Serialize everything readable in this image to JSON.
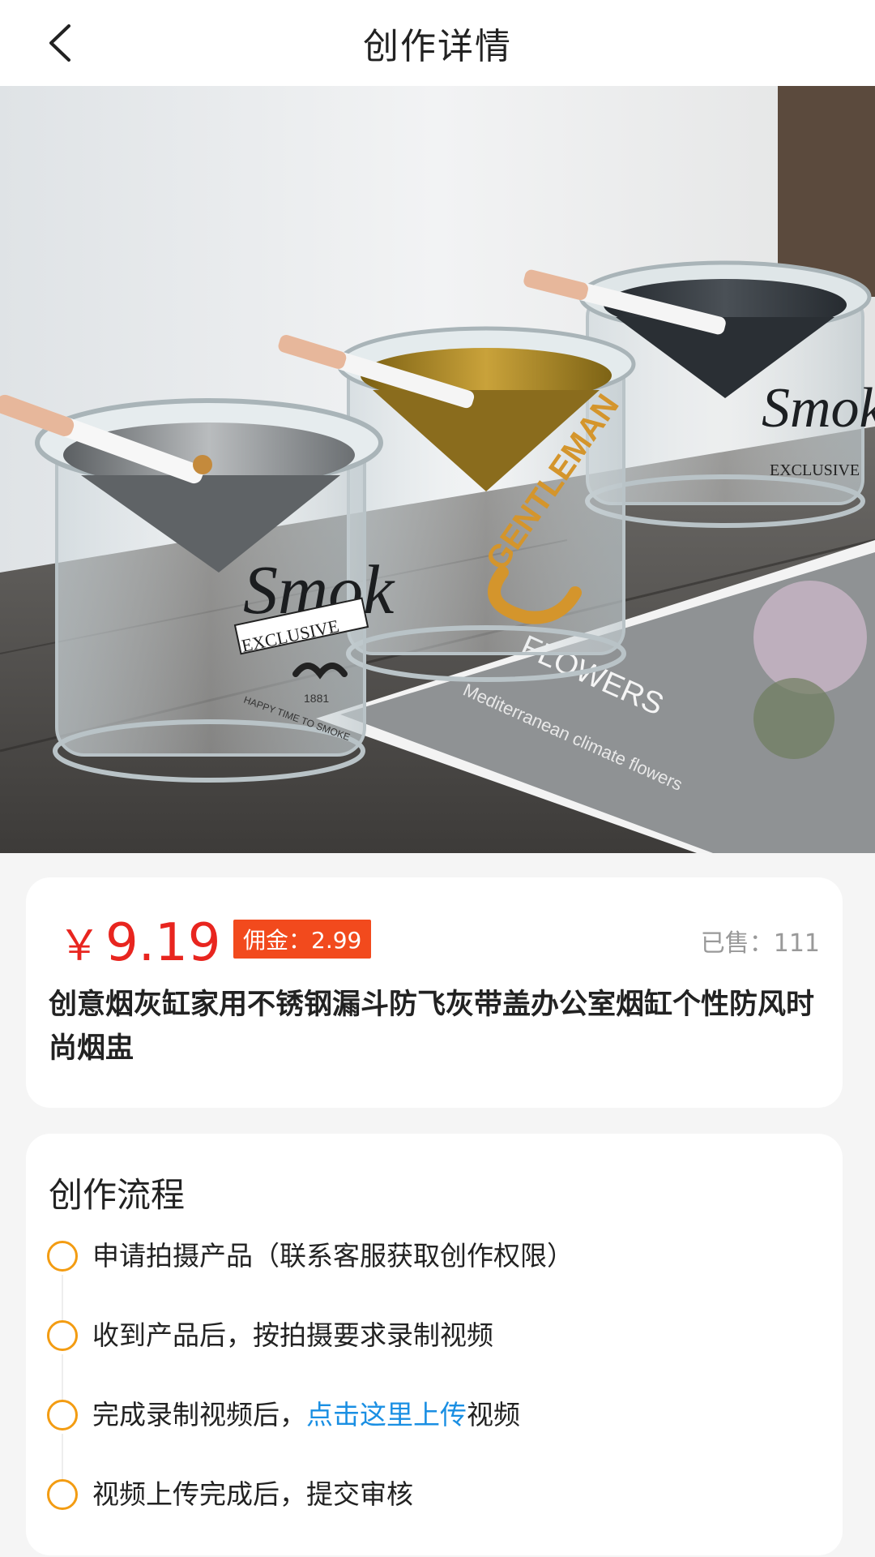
{
  "header": {
    "title": "创作详情"
  },
  "product": {
    "price_symbol": "￥",
    "price": "9.19",
    "commission": "佣金：2.99",
    "sold": "已售：111",
    "title": "创意烟灰缸家用不锈钢漏斗防飞灰带盖办公室烟缸个性防风时尚烟盅",
    "image": {
      "texts": {
        "left_jar_script": "Smok",
        "left_jar_label": "EXCLUSIVE",
        "left_jar_tagline": "HAPPY TIME TO SMOKE",
        "left_jar_year": "1881",
        "middle_jar_label": "GENTLEMAN",
        "right_jar_script": "Smok",
        "right_jar_label": "EXCLUSIVE",
        "magazine_title": "FLOWERS",
        "magazine_subtitle": "Mediterranean climate flowers"
      }
    }
  },
  "flow": {
    "title": "创作流程",
    "steps": [
      {
        "text": "申请拍摄产品（联系客服获取创作权限）"
      },
      {
        "text": "收到产品后，按拍摄要求录制视频"
      },
      {
        "before": "完成录制视频后，",
        "link": "点击这里上传",
        "after": "视频"
      },
      {
        "text": "视频上传完成后，提交审核"
      }
    ]
  },
  "colors": {
    "price": "#e8251f",
    "commission_bg": "#f24a1d",
    "step_circle": "#f39c12",
    "link": "#1a8fe3"
  }
}
